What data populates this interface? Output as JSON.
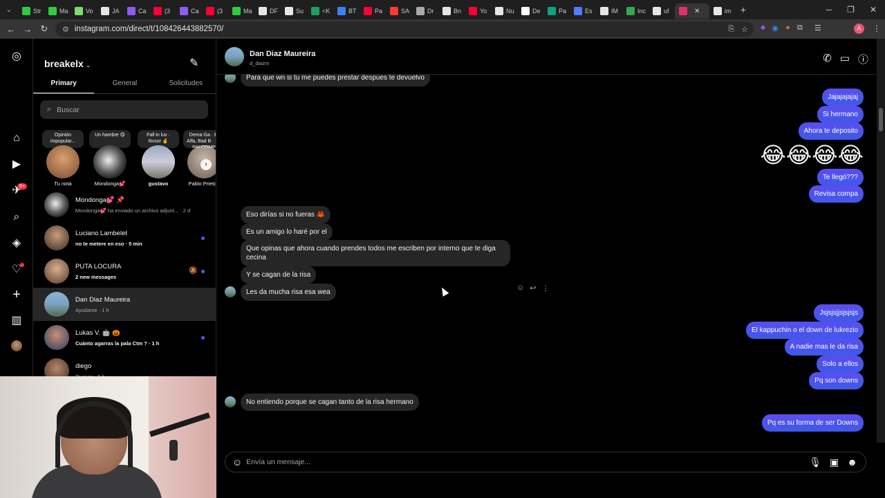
{
  "browser": {
    "tabs": [
      {
        "label": "Str",
        "color": "#2ecc40"
      },
      {
        "label": "Ma",
        "color": "#2ecc40"
      },
      {
        "label": "Vo",
        "color": "#7fdb6f"
      },
      {
        "label": "JA",
        "color": "#e6e6e6"
      },
      {
        "label": "Ca",
        "color": "#8b5cf6"
      },
      {
        "label": "(3",
        "color": "#ff0033"
      },
      {
        "label": "Ca",
        "color": "#8b5cf6"
      },
      {
        "label": "(3",
        "color": "#ff0033"
      },
      {
        "label": "Ma",
        "color": "#2ecc40"
      },
      {
        "label": "DF",
        "color": "#e6e6e6"
      },
      {
        "label": "Su",
        "color": "#e6e6e6"
      },
      {
        "label": "<K",
        "color": "#1aa260"
      },
      {
        "label": "BT",
        "color": "#3b82f6"
      },
      {
        "label": "Pa",
        "color": "#ff0033"
      },
      {
        "label": "SA",
        "color": "#ff3b30"
      },
      {
        "label": "Dr",
        "color": "#aaaaaa"
      },
      {
        "label": "Bn",
        "color": "#e6e6e6"
      },
      {
        "label": "Yo",
        "color": "#ff0033"
      },
      {
        "label": "Nu",
        "color": "#e6e6e6"
      },
      {
        "label": "De",
        "color": "#ffffff"
      },
      {
        "label": "Pa",
        "color": "#10a37f"
      },
      {
        "label": "Es",
        "color": "#4f7cff"
      },
      {
        "label": "IM",
        "color": "#e6e6e6"
      },
      {
        "label": "Inc",
        "color": "#34a853"
      },
      {
        "label": "uf",
        "color": "#e6e6e6"
      },
      {
        "label": "",
        "color": "#e1306c",
        "active": true
      },
      {
        "label": "im",
        "color": "#e6e6e6"
      }
    ],
    "url": "instagram.com/direct/t/108426443882570/"
  },
  "inbox": {
    "username": "breakelx",
    "tabs": [
      "Primary",
      "General",
      "Solicitudes"
    ],
    "search_placeholder": "Buscar",
    "notes": [
      {
        "note": "Opinión impopular...",
        "name": "Tu nota"
      },
      {
        "note": "Un hambre 😋",
        "name": "Mondonga💕"
      },
      {
        "note": "Fall in luv · Nvsor 🤞",
        "name": "gustavo"
      },
      {
        "note": "Dema Ga · El Alfa, Bad B · EL PAI COMP",
        "name": "Pablo Prieto I"
      }
    ],
    "conversations": [
      {
        "name": "Mondonga💕 📌",
        "preview": "Mondonga💕 ha enviado un archivo adjunt... · 2 d",
        "unread": false
      },
      {
        "name": "Luciano Lambelet",
        "preview": "no te metere en eso · 5 min",
        "unread": true
      },
      {
        "name": "PUTA LOCURA",
        "preview": "2 new messages",
        "unread": true,
        "muted": true
      },
      {
        "name": "Dan Diaz Maureira",
        "preview": "Ayudame · 1 h",
        "unread": false,
        "selected": true
      },
      {
        "name": "Lukas V. 🤖 🎃",
        "preview": "Cuánto agarras la pala Ctm ? · 1 h",
        "unread": true
      },
      {
        "name": "diego",
        "preview": "Te re re · 5 h",
        "unread": false
      }
    ],
    "rail_badge": "9+"
  },
  "chat": {
    "name": "Dan Diaz Maureira",
    "handle": "d_diazm",
    "messages": {
      "m0": "Para que wn si tu me puedes prestar despues te devuelvo",
      "m1": "Jajajajajaj",
      "m2": "Si hermano",
      "m3": "Ahora te deposito",
      "emojis": "😂😂😂😂",
      "m4": "Te llegó???",
      "m5": "Revisa compa",
      "m6": "Eso dirías si no fueras 🦀",
      "m7": "Es un amigo lo haré por el",
      "m8": "Que opinas que ahora cuando prendes todos me escriben por interno que te diga cecina",
      "m9": "Y se cagan de la risa",
      "m10": "Les da mucha risa esa wea",
      "m11": "Jsjsjsjjsjsjsjs",
      "m12": "El kappuchin o el down de lukrezio",
      "m13": "A nadie mas le da risa",
      "m14": "Solo a ellos",
      "m15": "Pq son downs",
      "m16": "No entiendo porque se cagan tanto de la risa hermano",
      "m17": "Pq es su forma de ser Downs"
    },
    "composer_placeholder": "Envía un mensaje...",
    "reaction": "❤️"
  }
}
